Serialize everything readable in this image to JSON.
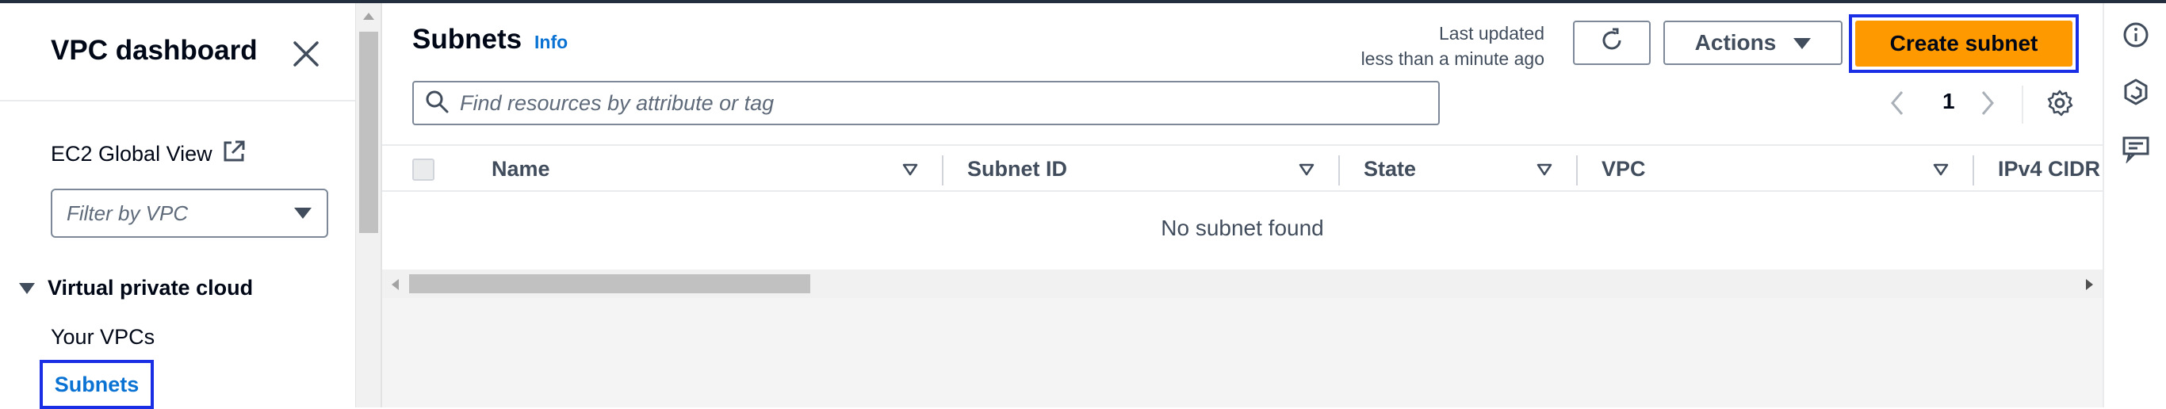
{
  "sidebar": {
    "title": "VPC dashboard",
    "ec2_global_view": "EC2 Global View",
    "filter_placeholder": "Filter by VPC",
    "section_title": "Virtual private cloud",
    "items": [
      {
        "label": "Your VPCs"
      },
      {
        "label": "Subnets"
      }
    ]
  },
  "header": {
    "title": "Subnets",
    "info_link": "Info",
    "last_updated_line1": "Last updated",
    "last_updated_line2": "less than a minute ago",
    "actions_label": "Actions",
    "create_label": "Create subnet"
  },
  "search": {
    "placeholder": "Find resources by attribute or tag"
  },
  "pagination": {
    "current_page": "1"
  },
  "table": {
    "columns": [
      "Name",
      "Subnet ID",
      "State",
      "VPC",
      "IPv4 CIDR"
    ],
    "empty_message": "No subnet found"
  },
  "colors": {
    "accent_orange": "#ff9900",
    "link_blue": "#0972d3",
    "highlight_box": "#1a2ee6"
  },
  "icons": [
    "close-icon",
    "external-link-icon",
    "caret-down-icon",
    "refresh-icon",
    "search-icon",
    "chevron-left-icon",
    "chevron-right-icon",
    "gear-icon",
    "info-icon",
    "hexagon-icon",
    "feedback-icon"
  ]
}
